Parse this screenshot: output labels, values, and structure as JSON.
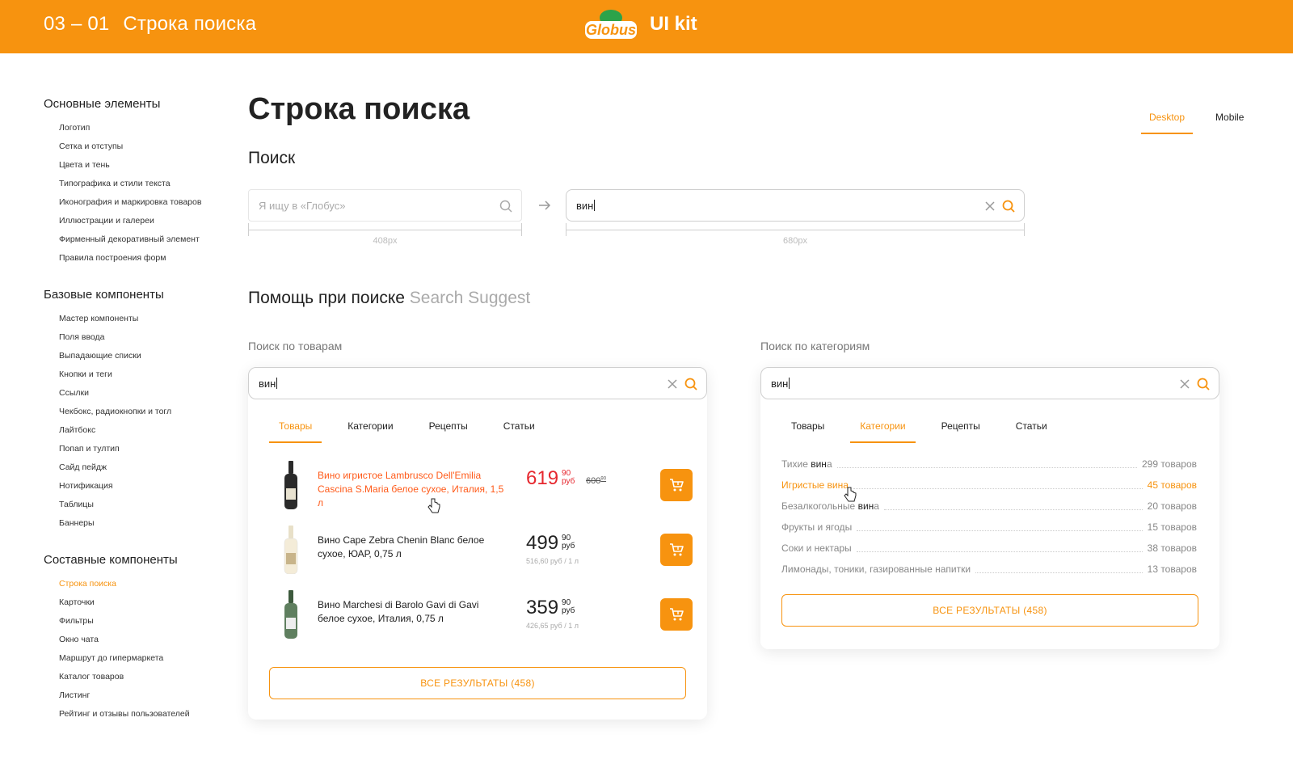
{
  "header": {
    "section_number": "03 – 01",
    "section_title": "Строка поиска",
    "logo_text": "Globus",
    "kit_label": "UI kit"
  },
  "sidebar": {
    "groups": [
      {
        "title": "Основные элементы",
        "items": [
          "Логотип",
          "Сетка и отступы",
          "Цвета и тень",
          "Типографика и стили текста",
          "Иконография и маркировка товаров",
          "Иллюстрации и галереи",
          "Фирменный декоративный элемент",
          "Правила построения форм"
        ]
      },
      {
        "title": "Базовые компоненты",
        "items": [
          "Мастер компоненты",
          "Поля ввода",
          "Выпадающие списки",
          "Кнопки и теги",
          "Ссылки",
          "Чекбокс, радиокнопки и тогл",
          "Лайтбокс",
          "Попап и тултип",
          "Сайд пейдж",
          "Нотификация",
          "Таблицы",
          "Баннеры"
        ]
      },
      {
        "title": "Составные компоненты",
        "items": [
          "Строка поиска",
          "Карточки",
          "Фильтры",
          "Окно чата",
          "Маршрут до гипермаркета",
          "Каталог товаров",
          "Листинг",
          "Рейтинг и отзывы пользователей"
        ]
      }
    ]
  },
  "page": {
    "title": "Строка поиска",
    "view_tabs": [
      "Desktop",
      "Mobile"
    ]
  },
  "search_section": {
    "title": "Поиск",
    "placeholder": "Я ищу в «Глобус»",
    "query": "вин",
    "small_width_label": "408px",
    "large_width_label": "680px"
  },
  "suggest_section": {
    "title": "Помощь при поиске",
    "title_en": "Search Suggest",
    "tabs": [
      "Товары",
      "Категории",
      "Рецепты",
      "Статьи"
    ],
    "products_panel": {
      "label": "Поиск по товарам",
      "query": "вин",
      "products": [
        {
          "name": "Вино игристое Lambrusco Dell'Emilia Cascina S.Maria белое сухое, Италия, 1,5 л",
          "price": "619",
          "kop": "90",
          "currency": "руб",
          "old_price": "600",
          "old_kop": "90",
          "unit_price": ""
        },
        {
          "name": "Вино Cape Zebra Chenin Blanc белое сухое, ЮАР, 0,75 л",
          "price": "499",
          "kop": "90",
          "currency": "руб",
          "unit_price": "516,60 руб / 1 л"
        },
        {
          "name": "Вино Marchesi di Barolo Gavi di Gavi белое сухое, Италия, 0,75 л",
          "price": "359",
          "kop": "90",
          "currency": "руб",
          "unit_price": "426,65 руб / 1 л"
        }
      ],
      "all_results": "ВСЕ РЕЗУЛЬТАТЫ (458)"
    },
    "categories_panel": {
      "label": "Поиск по категориям",
      "query": "вин",
      "categories": [
        {
          "prefix": "Тихие ",
          "match": "вин",
          "suffix": "а",
          "count": "299 товаров"
        },
        {
          "prefix": "Игристые ",
          "match": "вин",
          "suffix": "а",
          "count": "45 товаров"
        },
        {
          "prefix": "Безалкогольные ",
          "match": "вин",
          "suffix": "а",
          "count": "20 товаров"
        },
        {
          "prefix": "Фрукты и ягоды",
          "match": "",
          "suffix": "",
          "count": "15 товаров"
        },
        {
          "prefix": "Соки и нектары",
          "match": "",
          "suffix": "",
          "count": "38 товаров"
        },
        {
          "prefix": "Лимонады, тоники, газированные напитки",
          "match": "",
          "suffix": "",
          "count": "13 товаров"
        }
      ],
      "all_results": "ВСЕ РЕЗУЛЬТАТЫ (458)"
    }
  },
  "colors": {
    "brand_orange": "#f7930f",
    "sale_red": "#e6282f",
    "logo_green": "#2ba34a"
  }
}
